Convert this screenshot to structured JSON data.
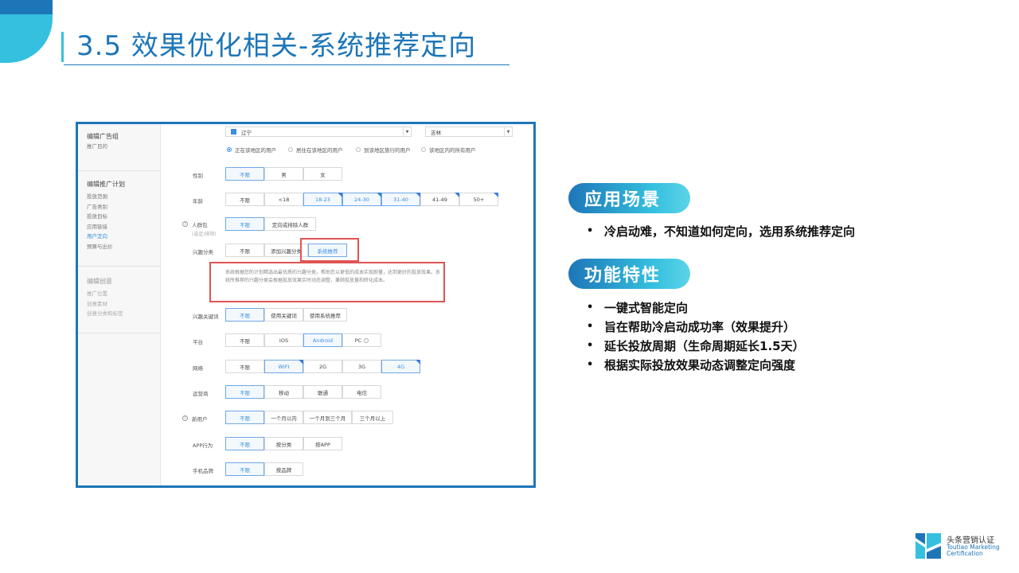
{
  "slide": {
    "title": "3.5 效果优化相关-系统推荐定向",
    "colors": {
      "primary": "#1d76b8",
      "accent": "#35c0df",
      "highlight": "#e05353"
    }
  },
  "sidebar": {
    "group1": {
      "head": "编辑广告组",
      "items": [
        "推广目的"
      ]
    },
    "group2": {
      "head": "编辑推广计划",
      "items": [
        "投放范围",
        "广告类别",
        "投放目标",
        "应用链接",
        "用户定向",
        "预算与出价"
      ],
      "active_index": 4
    },
    "group3": {
      "head": "编辑创意",
      "items": [
        "推广位置",
        "创意素材",
        "创意分类和标签"
      ]
    }
  },
  "form": {
    "region_select": "辽宁",
    "city_select": "吉林",
    "location_radios": [
      "正在该地区的用户",
      "居住在该地区的用户",
      "到该地区旅行的用户",
      "该地区内的所有用户"
    ],
    "gender": {
      "label": "性别",
      "options": [
        "不限",
        "男",
        "女"
      ]
    },
    "age": {
      "label": "年龄",
      "options": [
        "不限",
        "<18",
        "18-23",
        "24-30",
        "31-40",
        "41-49",
        "50+"
      ]
    },
    "crowd": {
      "label": "人群包",
      "sub": "(选定/排除)",
      "options": [
        "不限",
        "定向或排除人群"
      ]
    },
    "interest_cat": {
      "label": "兴趣分类",
      "options": [
        "不限",
        "添加兴趣分类",
        "系统推荐"
      ]
    },
    "description": "系统根据您的计划精选出最优质的兴趣分类，帮助您以更低的成本实现跑量，达到更好的投放效果。系统所推荐的兴趣分类会根据投放效果实时动态调整，兼顾投放量和转化成本。",
    "interest_kw": {
      "label": "兴趣关键词",
      "options": [
        "不限",
        "使用关键词",
        "使用系统推荐"
      ]
    },
    "platform": {
      "label": "平台",
      "options": [
        "不限",
        "IOS",
        "Android",
        "PC"
      ]
    },
    "network": {
      "label": "网络",
      "options": [
        "不限",
        "WIFI",
        "2G",
        "3G",
        "4G"
      ]
    },
    "carrier": {
      "label": "运营商",
      "options": [
        "不限",
        "移动",
        "联通",
        "电信"
      ]
    },
    "new_user": {
      "label": "新用户",
      "options": [
        "不限",
        "一个月以内",
        "一个月到三个月",
        "三个月以上"
      ]
    },
    "app_behavior": {
      "label": "APP行为",
      "options": [
        "不限",
        "按分类",
        "按APP"
      ]
    },
    "phone_brand": {
      "label": "手机品牌",
      "options": [
        "不限",
        "按品牌"
      ]
    }
  },
  "right": {
    "section1": {
      "title": "应用场景",
      "bullets": [
        "冷启动难，不知道如何定向，选用系统推荐定向"
      ]
    },
    "section2": {
      "title": "功能特性",
      "bullets": [
        "一键式智能定向",
        "旨在帮助冷启动成功率（效果提升）",
        "延长投放周期（生命周期延长1.5天）",
        "根据实际投放效果动态调整定向强度"
      ]
    },
    "bullet_char": "•"
  },
  "logo": {
    "cn": "头条营销认证",
    "en1": "Toutiao Marketing",
    "en2": "Certification"
  }
}
